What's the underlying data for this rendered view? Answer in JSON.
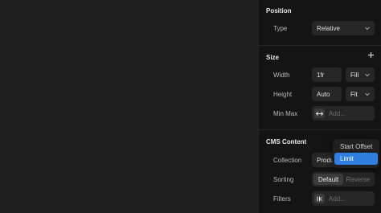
{
  "position": {
    "title": "Position",
    "type_label": "Type",
    "type_value": "Relative"
  },
  "size": {
    "title": "Size",
    "width_label": "Width",
    "width_value": "1fr",
    "width_mode": "Fill",
    "height_label": "Height",
    "height_value": "Auto",
    "height_mode": "Fit",
    "minmax_label": "Min Max",
    "minmax_placeholder": "Add..."
  },
  "cms": {
    "title": "CMS Content",
    "collection_label": "Collection",
    "collection_value": "Produc",
    "sorting_label": "Sorting",
    "sorting_options": [
      "Default",
      "Reverse"
    ],
    "filters_label": "Filters",
    "filters_placeholder": "Add..."
  },
  "dropdown": {
    "items": [
      "Start Offset",
      "Limit"
    ],
    "selected": "Limit"
  },
  "colors": {
    "canvas": "#1e1e1e",
    "panel": "#141414",
    "field": "#262626",
    "accent": "#2f7ee0"
  }
}
